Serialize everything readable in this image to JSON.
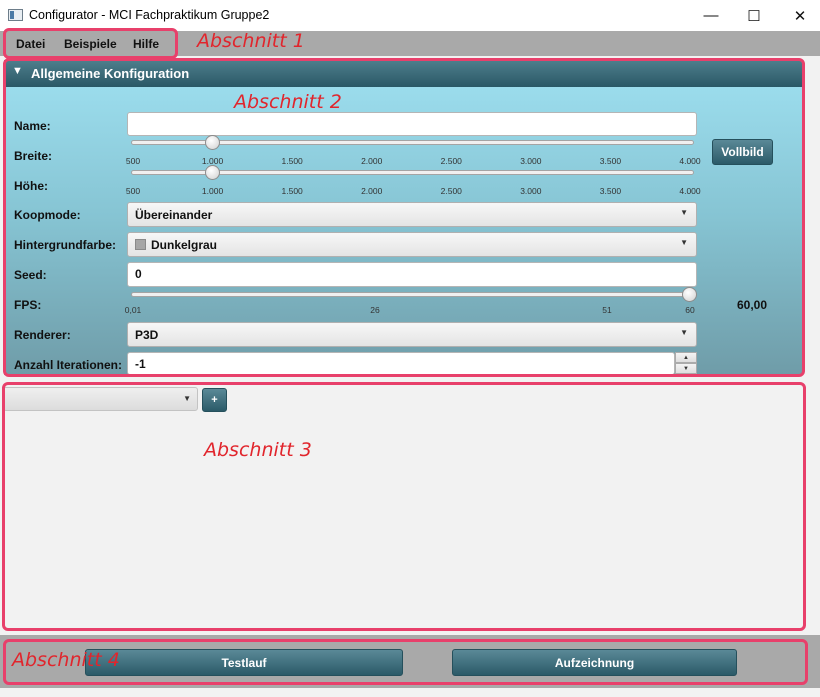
{
  "window": {
    "title": "Configurator - MCI Fachpraktikum Gruppe2",
    "minimize": "—",
    "maximize": "☐",
    "close": "✕"
  },
  "menu": {
    "items": [
      "Datei",
      "Beispiele",
      "Hilfe"
    ]
  },
  "annotations": {
    "section1": "Abschnitt 1",
    "section2": "Abschnitt 2",
    "section3": "Abschnitt 3",
    "section4": "Abschnitt 4"
  },
  "config": {
    "header": "Allgemeine Konfiguration",
    "name": {
      "label": "Name:",
      "value": ""
    },
    "breite": {
      "label": "Breite:",
      "value": 1000,
      "min": 500,
      "max": 4000,
      "ticks": [
        "500",
        "1.000",
        "1.500",
        "2.000",
        "2.500",
        "3.000",
        "3.500",
        "4.000"
      ]
    },
    "hoehe": {
      "label": "Höhe:",
      "value": 1000,
      "min": 500,
      "max": 4000,
      "ticks": [
        "500",
        "1.000",
        "1.500",
        "2.000",
        "2.500",
        "3.000",
        "3.500",
        "4.000"
      ]
    },
    "vollbild": "Vollbild",
    "koopmode": {
      "label": "Koopmode:",
      "value": "Übereinander"
    },
    "hintergrundfarbe": {
      "label": "Hintergrundfarbe:",
      "value": "Dunkelgrau",
      "swatch": "#a6a6a6"
    },
    "seed": {
      "label": "Seed:",
      "value": "0"
    },
    "fps": {
      "label": "FPS:",
      "value": 60,
      "display": "60,00",
      "min": 0.01,
      "max": 60,
      "ticks": [
        "0,01",
        "26",
        "51",
        "60"
      ]
    },
    "renderer": {
      "label": "Renderer:",
      "value": "P3D"
    },
    "iterationen": {
      "label": "Anzahl Iterationen:",
      "value": "-1"
    }
  },
  "section3": {
    "add_label": "+"
  },
  "actions": {
    "testlauf": "Testlauf",
    "aufzeichnung": "Aufzeichnung"
  },
  "colors": {
    "accent": "#2b5a68",
    "annotation": "#e8406b",
    "annotation_text": "#e1252c"
  }
}
